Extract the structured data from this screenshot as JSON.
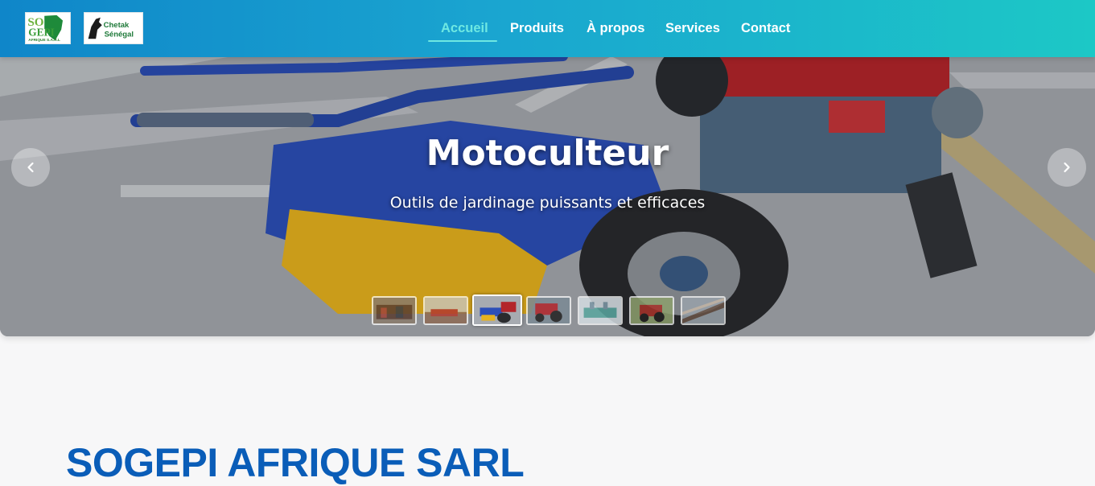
{
  "brand": {
    "logo_primary_text": "SO GEPI",
    "logo_primary_subtext": "AFRIQUE S.A.R.L",
    "logo_secondary_text": "Chetak",
    "logo_secondary_subtext": "Sénégal",
    "colors": {
      "nav_gradient_start": "#0f86c9",
      "nav_gradient_end": "#1cc8c6",
      "active_link": "#6ee8e2",
      "heading_blue": "#0a5db8"
    }
  },
  "nav": {
    "items": [
      {
        "label": "Accueil",
        "active": true
      },
      {
        "label": "Produits",
        "active": false
      },
      {
        "label": "À propos",
        "active": false
      },
      {
        "label": "Services",
        "active": false
      },
      {
        "label": "Contact",
        "active": false
      }
    ]
  },
  "hero": {
    "title": "Motoculteur",
    "subtitle": "Outils de jardinage puissants et efficaces",
    "prev_icon": "chevron-left-icon",
    "next_icon": "chevron-right-icon",
    "thumbnails": [
      {
        "name": "slide-1",
        "active": false
      },
      {
        "name": "slide-2",
        "active": false
      },
      {
        "name": "slide-3",
        "active": true
      },
      {
        "name": "slide-4",
        "active": false
      },
      {
        "name": "slide-5",
        "active": false
      },
      {
        "name": "slide-6",
        "active": false
      },
      {
        "name": "slide-7",
        "active": false
      }
    ]
  },
  "main": {
    "company_title": "SOGEPI AFRIQUE SARL"
  }
}
